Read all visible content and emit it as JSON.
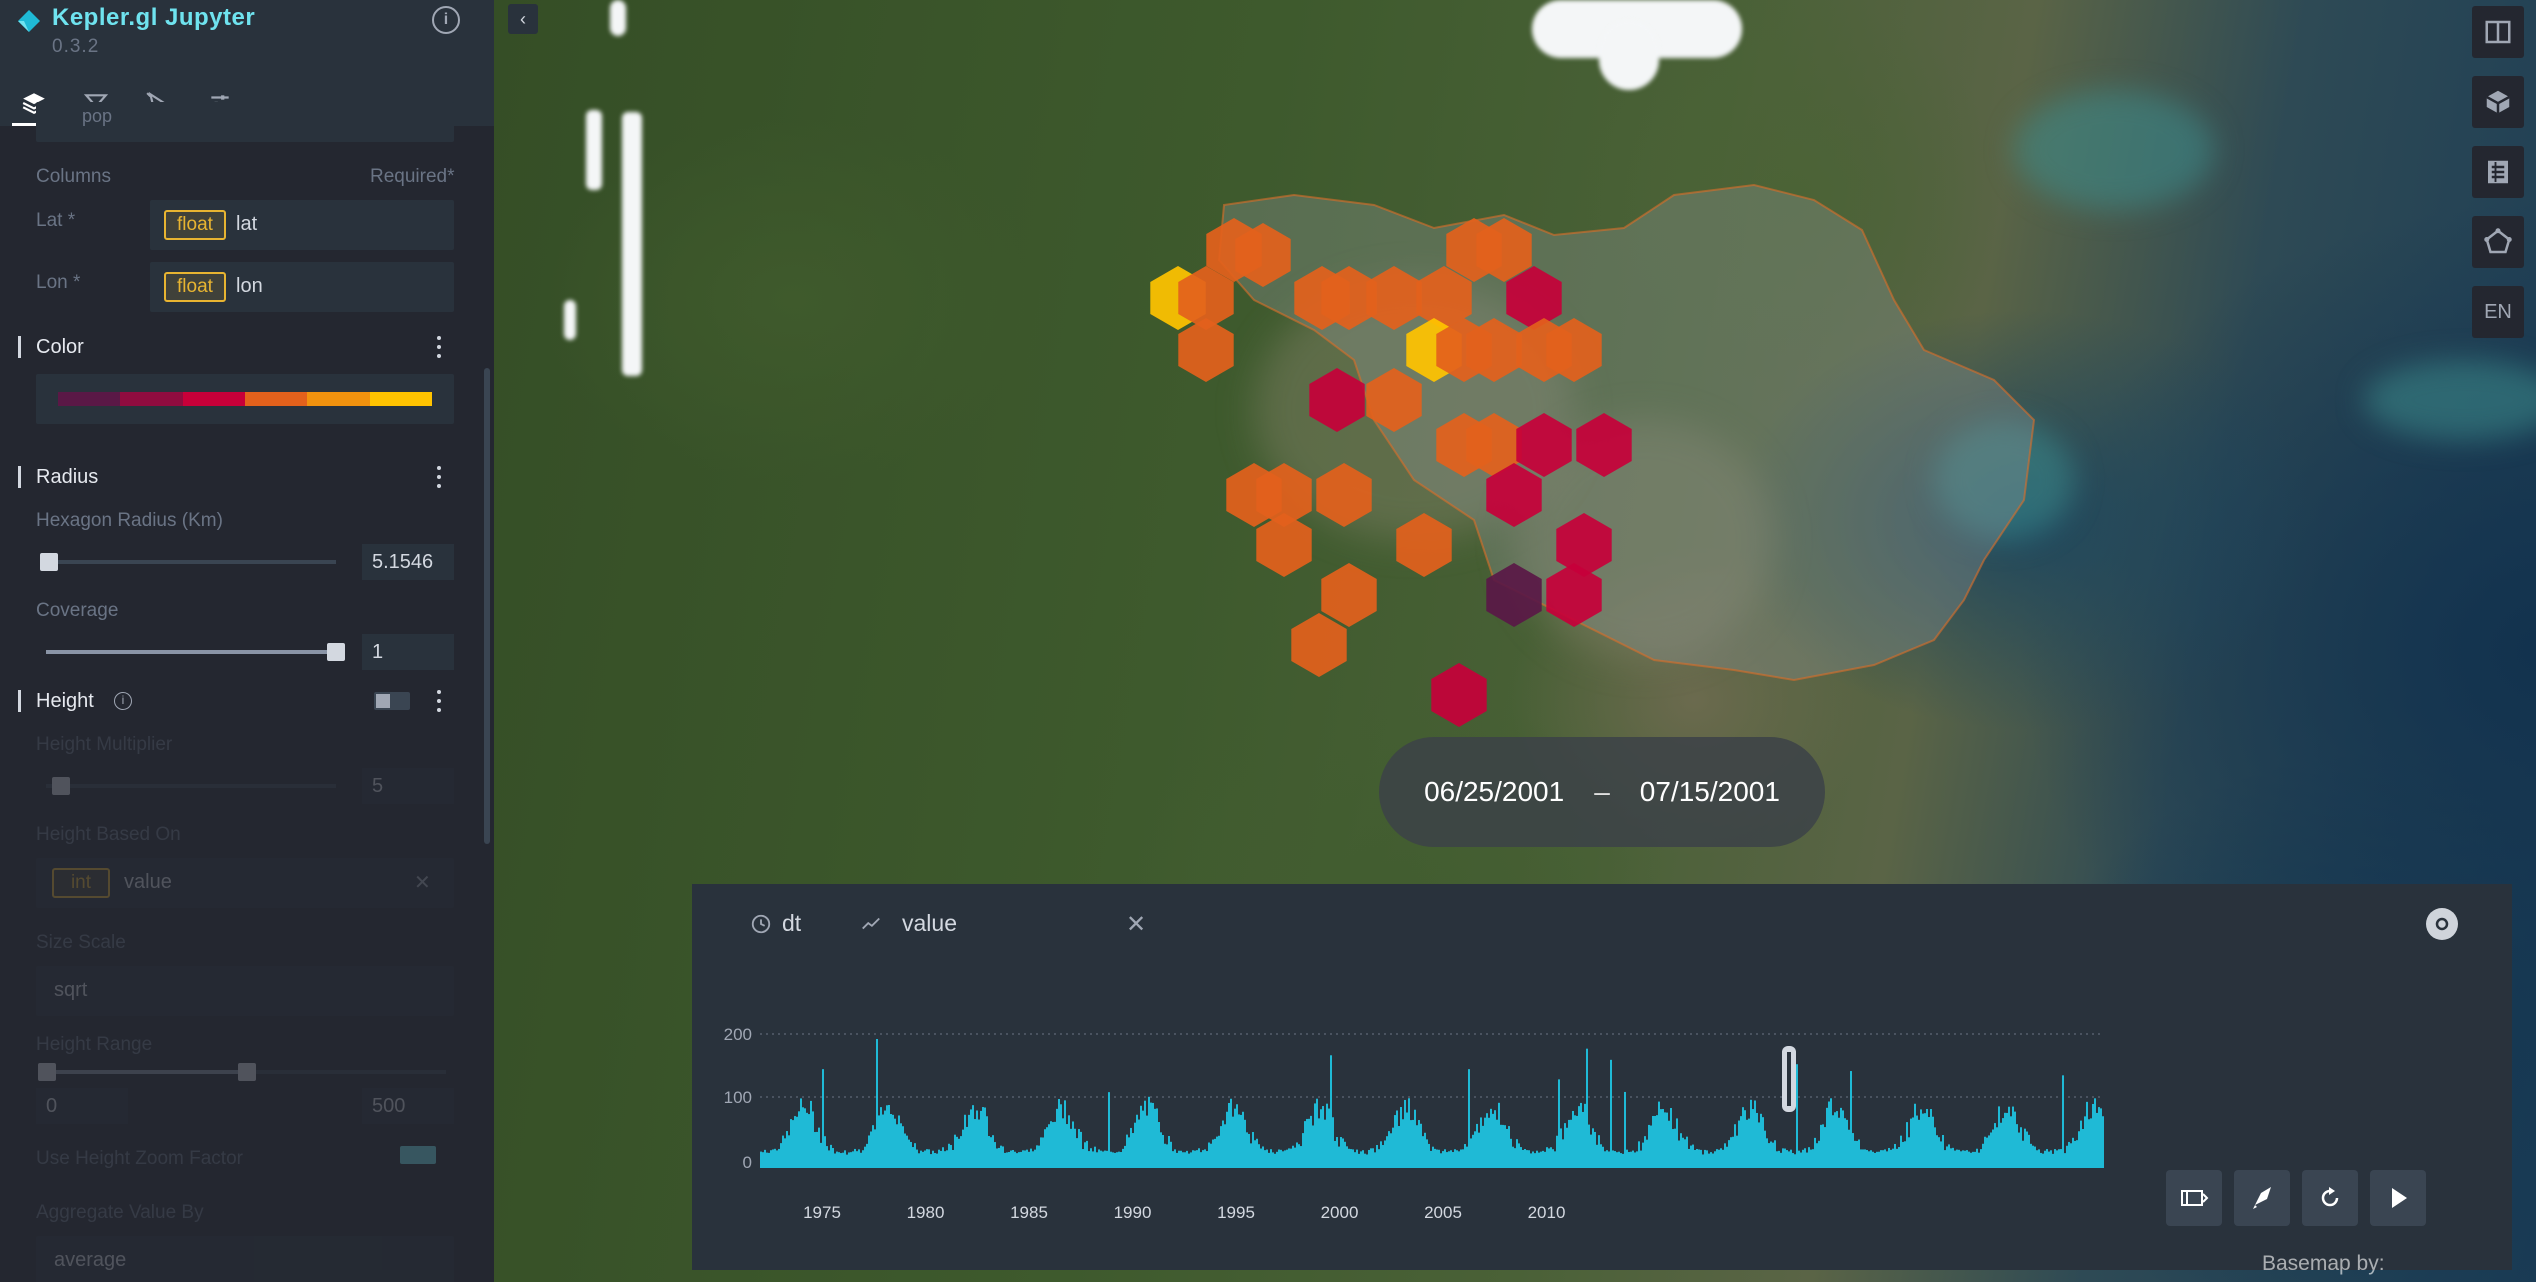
{
  "app": {
    "title": "Kepler.gl Jupyter",
    "version": "0.3.2",
    "accent_color": "#6fe3ef"
  },
  "nav_tabs": [
    {
      "name": "layers",
      "icon": "layers-icon",
      "active": true
    },
    {
      "name": "filters",
      "icon": "filter-icon",
      "active": false
    },
    {
      "name": "interactions",
      "icon": "cursor-icon",
      "active": false
    },
    {
      "name": "map-style",
      "icon": "sliders-icon",
      "active": false
    }
  ],
  "layer_config": {
    "truncated_field": "pop",
    "columns": {
      "label": "Columns",
      "required_label": "Required*",
      "lat": {
        "label": "Lat *",
        "type": "float",
        "value": "lat"
      },
      "lon": {
        "label": "Lon *",
        "type": "float",
        "value": "lon"
      }
    },
    "color": {
      "title": "Color",
      "palette": [
        "#5a1846",
        "#900c3f",
        "#c70039",
        "#e3611c",
        "#f1920e",
        "#ffc300"
      ]
    },
    "radius": {
      "title": "Radius",
      "hexagon_radius_label": "Hexagon Radius (Km)",
      "hexagon_radius_value": "5.1546",
      "coverage_label": "Coverage",
      "coverage_value": "1",
      "coverage_fraction": 1.0,
      "radius_fraction": 0.0
    },
    "height": {
      "title": "Height",
      "enabled": false,
      "multiplier_label": "Height Multiplier",
      "multiplier_value": "5",
      "based_on_label": "Height Based On",
      "based_on_type": "int",
      "based_on_value": "value",
      "size_scale_label": "Size Scale",
      "size_scale_value": "sqrt",
      "range_label": "Height Range",
      "range_min": "0",
      "range_max": "500",
      "zoom_factor_label": "Use Height Zoom Factor",
      "aggregate_label": "Aggregate Value By",
      "aggregate_value": "average"
    }
  },
  "map": {
    "date_range_start": "06/25/2001",
    "date_range_sep": "–",
    "date_range_end": "07/15/2001",
    "controls": [
      {
        "name": "split-map-icon"
      },
      {
        "name": "3d-view-icon"
      },
      {
        "name": "legend-icon"
      },
      {
        "name": "draw-polygon-icon"
      },
      {
        "name": "locale-button",
        "label": "EN"
      }
    ],
    "basemap_credit": "Basemap by:",
    "hex_colors": {
      "c1": "#5a1846",
      "c2": "#c70039",
      "c3": "#e3611c",
      "c4": "#f1920e",
      "c5": "#ffc300"
    }
  },
  "timeline": {
    "field_label": "dt",
    "y_label": "value",
    "y_ticks": [
      "200",
      "100",
      "0"
    ],
    "x_ticks": [
      "1975",
      "1980",
      "1985",
      "1990",
      "1995",
      "2000",
      "2005",
      "2010"
    ],
    "bar_color": "#1fbad6",
    "playback_buttons": [
      "window-mode-icon",
      "speed-icon",
      "reset-icon",
      "play-icon"
    ]
  }
}
